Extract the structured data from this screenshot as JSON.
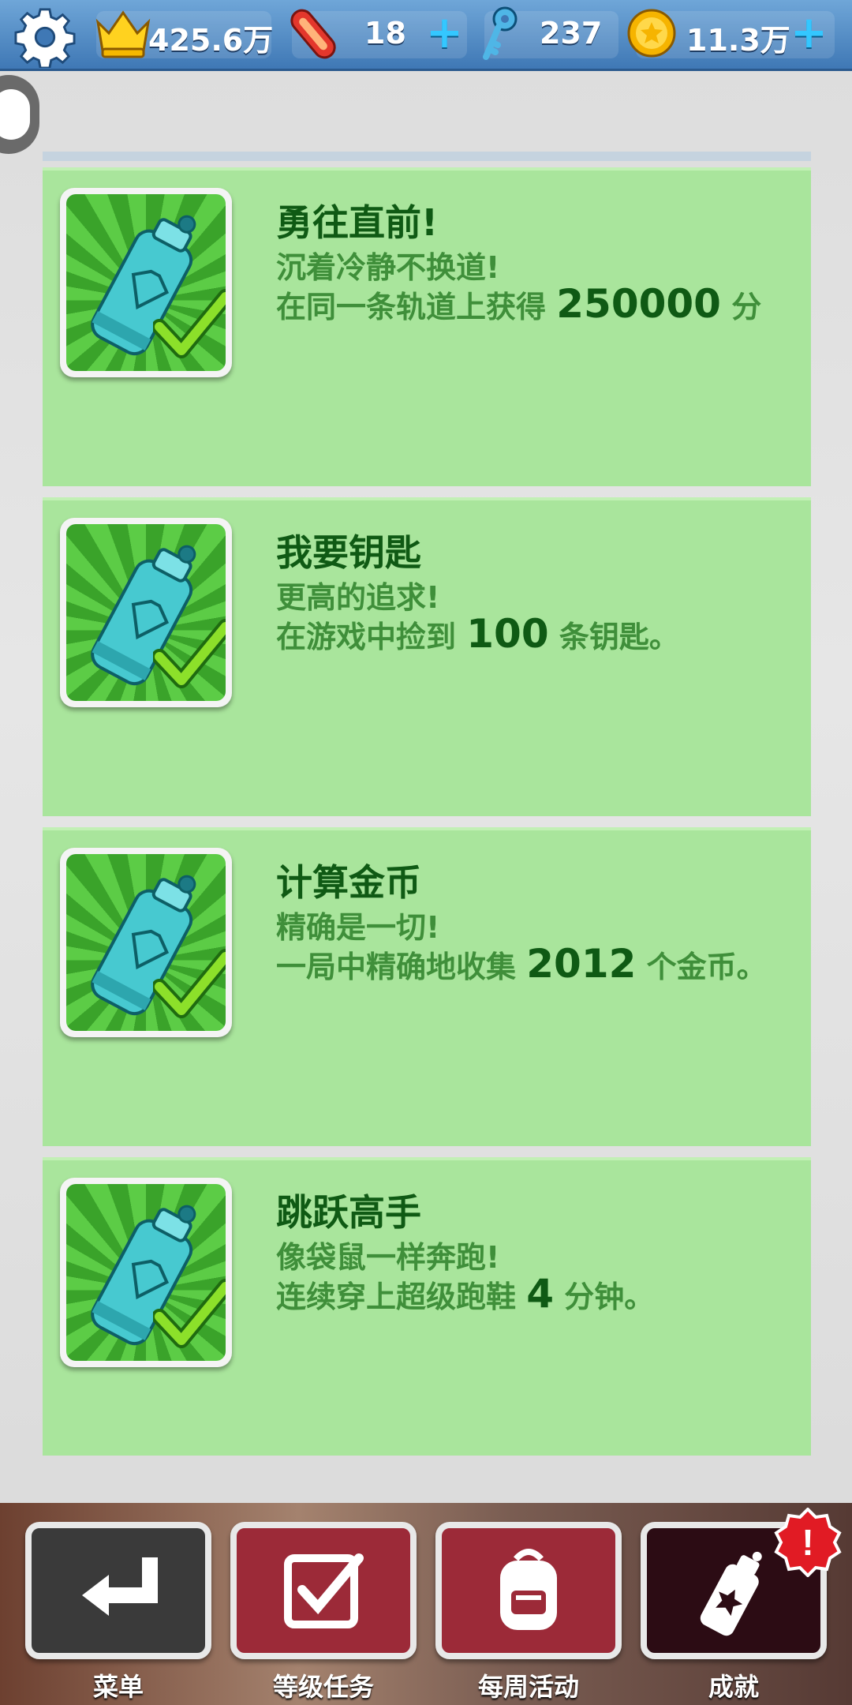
{
  "topbar": {
    "gear_icon": "gear-icon",
    "stats": [
      {
        "icon": "crown-icon",
        "value": "425.6万",
        "has_plus": false
      },
      {
        "icon": "hoverboard-icon",
        "value": "18",
        "has_plus": true
      },
      {
        "icon": "key-icon",
        "value": "237",
        "has_plus": false
      },
      {
        "icon": "coin-icon",
        "value": "11.3万",
        "has_plus": true
      }
    ]
  },
  "achievements": [
    {
      "title": "勇往直前!",
      "line1": "沉着冷静不换道!",
      "line2_pre": "在同一条轨道上获得 ",
      "line2_num": "250000",
      "line2_post": " 分",
      "icon": "spray-can-icon",
      "completed": true
    },
    {
      "title": "我要钥匙",
      "line1": "更高的追求!",
      "line2_pre": "在游戏中捡到 ",
      "line2_num": "100",
      "line2_post": " 条钥匙。",
      "icon": "spray-can-icon",
      "completed": true
    },
    {
      "title": "计算金币",
      "line1": "精确是一切!",
      "line2_pre": "一局中精确地收集 ",
      "line2_num": "2012",
      "line2_post": " 个金币。",
      "icon": "spray-can-icon",
      "completed": true
    },
    {
      "title": "跳跃高手",
      "line1": "像袋鼠一样奔跑!",
      "line2_pre": "连续穿上超级跑鞋 ",
      "line2_num": "4",
      "line2_post": " 分钟。",
      "icon": "spray-can-icon",
      "completed": true
    }
  ],
  "nav": [
    {
      "label": "菜单",
      "icon": "return-arrow-icon",
      "color": "#3a3a3a"
    },
    {
      "label": "等级任务",
      "icon": "checkbox-icon",
      "color": "#9c2a38"
    },
    {
      "label": "每周活动",
      "icon": "backpack-icon",
      "color": "#9c2a38"
    },
    {
      "label": "成就",
      "icon": "spray-can-icon",
      "color": "#2c0c14"
    }
  ],
  "alert": "!"
}
